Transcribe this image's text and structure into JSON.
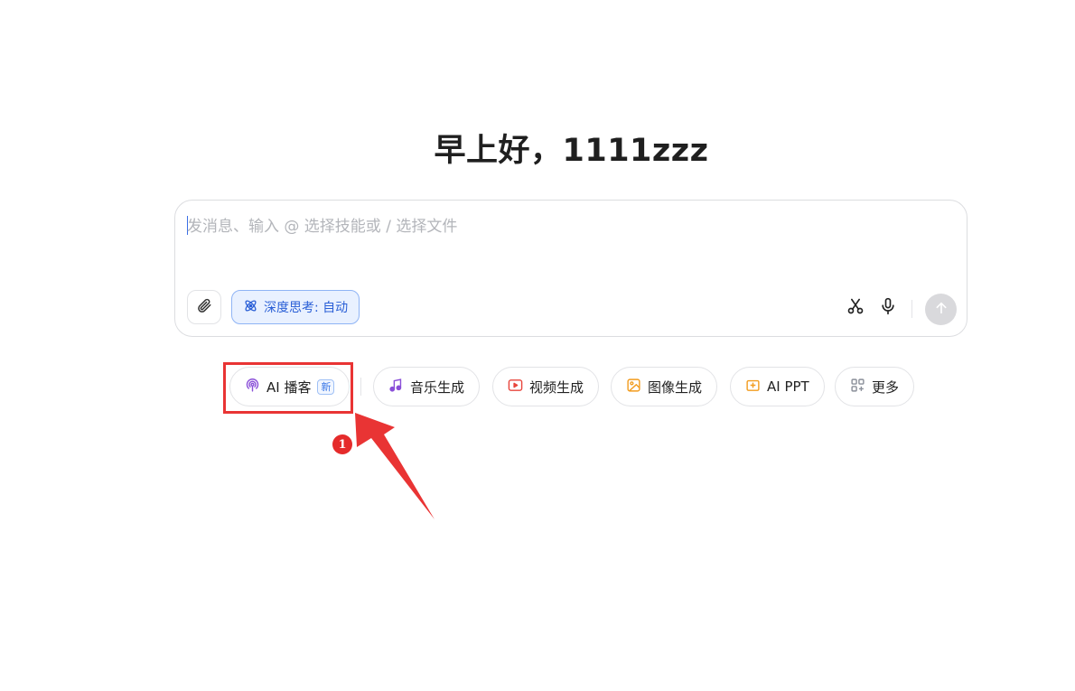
{
  "greeting": "早上好，1111zzz",
  "composer": {
    "placeholder": "发消息、输入 @ 选择技能或 / 选择文件",
    "think_label": "深度思考: 自动"
  },
  "chips": [
    {
      "label": "AI 播客",
      "icon": "podcast-icon",
      "badge": "新",
      "color": "#8a4fd8"
    },
    {
      "label": "音乐生成",
      "icon": "music-icon",
      "color": "#8a4fd8"
    },
    {
      "label": "视频生成",
      "icon": "video-icon",
      "color": "#e8453c"
    },
    {
      "label": "图像生成",
      "icon": "image-icon",
      "color": "#f29c1f"
    },
    {
      "label": "AI PPT",
      "icon": "ppt-icon",
      "color": "#f29c1f"
    },
    {
      "label": "更多",
      "icon": "grid-icon",
      "color": "#8a8f99"
    }
  ],
  "annotation": {
    "step_number": "1",
    "color": "#e93434"
  }
}
